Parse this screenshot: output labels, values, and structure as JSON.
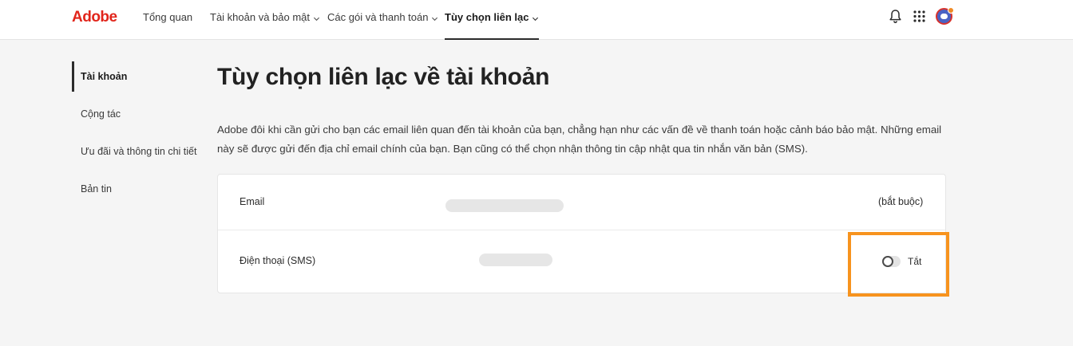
{
  "header": {
    "logo": "Adobe",
    "nav": [
      {
        "label": "Tổng quan",
        "has_dropdown": false
      },
      {
        "label": "Tài khoản và bảo mật",
        "has_dropdown": true
      },
      {
        "label": "Các gói và thanh toán",
        "has_dropdown": true
      },
      {
        "label": "Tùy chọn liên lạc",
        "has_dropdown": true,
        "active": true
      }
    ],
    "icons": [
      "bell-icon",
      "apps-grid-icon",
      "avatar"
    ]
  },
  "sidebar": {
    "items": [
      {
        "label": "Tài khoản",
        "active": true
      },
      {
        "label": "Cộng tác"
      },
      {
        "label": "Ưu đãi và thông tin chi tiết"
      },
      {
        "label": "Bản tin"
      }
    ]
  },
  "main": {
    "title": "Tùy chọn liên lạc về tài khoản",
    "description": "Adobe đôi khi cần gửi cho bạn các email liên quan đến tài khoản của bạn, chẳng hạn như các vấn đề về thanh toán hoặc cảnh báo bảo mật. Những email này sẽ được gửi đến địa chỉ email chính của bạn. Bạn cũng có thể chọn nhận thông tin cập nhật qua tin nhắn văn bản (SMS).",
    "rows": [
      {
        "label": "Email",
        "value_masked": true,
        "status": "(bắt buộc)"
      },
      {
        "label": "Điện thoại (SMS)",
        "value_masked": true,
        "toggle_on": false,
        "toggle_label": "Tắt"
      }
    ]
  },
  "colors": {
    "brand": "#e1251b",
    "highlight": "#f7931e",
    "background": "#f5f5f5"
  }
}
